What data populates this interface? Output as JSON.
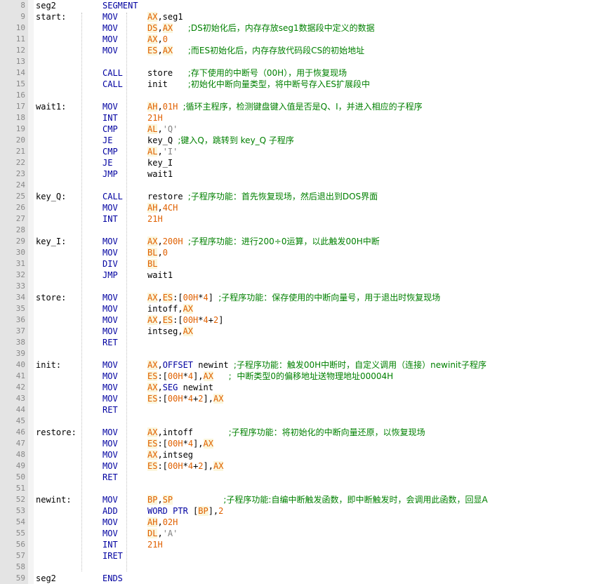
{
  "colors": {
    "background": "#ffffff",
    "gutter": "#e4e4e4",
    "line_number": "#888888",
    "instruction": "#0000a0",
    "register": "#e06000",
    "comment": "#008000",
    "string": "#808080"
  },
  "lines": [
    {
      "n": "8",
      "label": "seg2",
      "op": "SEGMENT",
      "args": []
    },
    {
      "n": "9",
      "label": "start:",
      "op": "MOV",
      "args": [
        {
          "t": "reg",
          "v": "AX"
        },
        {
          "t": "plain",
          "v": ",seg1"
        }
      ]
    },
    {
      "n": "10",
      "label": "",
      "op": "MOV",
      "args": [
        {
          "t": "reg",
          "v": "DS"
        },
        {
          "t": "plain",
          "v": ","
        },
        {
          "t": "reg",
          "v": "AX"
        },
        {
          "t": "plain",
          "v": "   "
        },
        {
          "t": "cmt",
          "v": ";DS初始化后，内存存放seg1数据段中定义的数据"
        }
      ]
    },
    {
      "n": "11",
      "label": "",
      "op": "MOV",
      "args": [
        {
          "t": "reg",
          "v": "AX"
        },
        {
          "t": "plain",
          "v": ","
        },
        {
          "t": "num",
          "v": "0"
        }
      ]
    },
    {
      "n": "12",
      "label": "",
      "op": "MOV",
      "args": [
        {
          "t": "reg",
          "v": "ES"
        },
        {
          "t": "plain",
          "v": ","
        },
        {
          "t": "reg",
          "v": "AX"
        },
        {
          "t": "plain",
          "v": "   "
        },
        {
          "t": "cmt",
          "v": ";而ES初始化后，内存存放代码段CS的初始地址"
        }
      ]
    },
    {
      "n": "13",
      "label": "",
      "op": "",
      "args": []
    },
    {
      "n": "14",
      "label": "",
      "op": "CALL",
      "args": [
        {
          "t": "plain",
          "v": "store   "
        },
        {
          "t": "cmt",
          "v": ";存下使用的中断号（00H），用于恢复现场"
        }
      ]
    },
    {
      "n": "15",
      "label": "",
      "op": "CALL",
      "args": [
        {
          "t": "plain",
          "v": "init    "
        },
        {
          "t": "cmt",
          "v": ";初始化中断向量类型，将中断号存入ES扩展段中"
        }
      ]
    },
    {
      "n": "16",
      "label": "",
      "op": "",
      "args": []
    },
    {
      "n": "17",
      "label": "wait1:",
      "op": "MOV",
      "args": [
        {
          "t": "reg",
          "v": "AH"
        },
        {
          "t": "plain",
          "v": ","
        },
        {
          "t": "num",
          "v": "01H"
        },
        {
          "t": "plain",
          "v": " "
        },
        {
          "t": "cmt",
          "v": ";循环主程序，检测键盘键入值是否是Q、I，并进入相应的子程序"
        }
      ]
    },
    {
      "n": "18",
      "label": "",
      "op": "INT",
      "args": [
        {
          "t": "num",
          "v": "21H"
        }
      ]
    },
    {
      "n": "19",
      "label": "",
      "op": "CMP",
      "args": [
        {
          "t": "reg",
          "v": "AL"
        },
        {
          "t": "plain",
          "v": ","
        },
        {
          "t": "str",
          "v": "'Q'"
        }
      ]
    },
    {
      "n": "20",
      "label": "",
      "op": "JE",
      "args": [
        {
          "t": "plain",
          "v": "key_Q "
        },
        {
          "t": "cmt",
          "v": ";键入Q，跳转到 key_Q 子程序"
        }
      ]
    },
    {
      "n": "21",
      "label": "",
      "op": "CMP",
      "args": [
        {
          "t": "reg",
          "v": "AL"
        },
        {
          "t": "plain",
          "v": ","
        },
        {
          "t": "str",
          "v": "'I'"
        }
      ]
    },
    {
      "n": "22",
      "label": "",
      "op": "JE",
      "args": [
        {
          "t": "plain",
          "v": "key_I"
        }
      ]
    },
    {
      "n": "23",
      "label": "",
      "op": "JMP",
      "args": [
        {
          "t": "plain",
          "v": "wait1"
        }
      ]
    },
    {
      "n": "24",
      "label": "",
      "op": "",
      "args": []
    },
    {
      "n": "25",
      "label": "key_Q:",
      "op": "CALL",
      "args": [
        {
          "t": "plain",
          "v": "restore "
        },
        {
          "t": "cmt",
          "v": ";子程序功能：首先恢复现场，然后退出到DOS界面"
        }
      ]
    },
    {
      "n": "26",
      "label": "",
      "op": "MOV",
      "args": [
        {
          "t": "reg",
          "v": "AH"
        },
        {
          "t": "plain",
          "v": ","
        },
        {
          "t": "num",
          "v": "4CH"
        }
      ]
    },
    {
      "n": "27",
      "label": "",
      "op": "INT",
      "args": [
        {
          "t": "num",
          "v": "21H"
        }
      ]
    },
    {
      "n": "28",
      "label": "",
      "op": "",
      "args": []
    },
    {
      "n": "29",
      "label": "key_I:",
      "op": "MOV",
      "args": [
        {
          "t": "reg",
          "v": "AX"
        },
        {
          "t": "plain",
          "v": ","
        },
        {
          "t": "num",
          "v": "200H"
        },
        {
          "t": "plain",
          "v": " "
        },
        {
          "t": "cmt",
          "v": ";子程序功能：进行200÷0运算，以此触发00H中断"
        }
      ]
    },
    {
      "n": "30",
      "label": "",
      "op": "MOV",
      "args": [
        {
          "t": "reg",
          "v": "BL"
        },
        {
          "t": "plain",
          "v": ","
        },
        {
          "t": "num",
          "v": "0"
        }
      ]
    },
    {
      "n": "31",
      "label": "",
      "op": "DIV",
      "args": [
        {
          "t": "reg",
          "v": "BL"
        }
      ]
    },
    {
      "n": "32",
      "label": "",
      "op": "JMP",
      "args": [
        {
          "t": "plain",
          "v": "wait1"
        }
      ]
    },
    {
      "n": "33",
      "label": "",
      "op": "",
      "args": []
    },
    {
      "n": "34",
      "label": "store:",
      "op": "MOV",
      "args": [
        {
          "t": "reg",
          "v": "AX"
        },
        {
          "t": "plain",
          "v": ","
        },
        {
          "t": "reg",
          "v": "ES"
        },
        {
          "t": "plain",
          "v": ":["
        },
        {
          "t": "num",
          "v": "00H"
        },
        {
          "t": "plain",
          "v": "*"
        },
        {
          "t": "num",
          "v": "4"
        },
        {
          "t": "plain",
          "v": "] "
        },
        {
          "t": "cmt",
          "v": ";子程序功能：保存使用的中断向量号，用于退出时恢复现场"
        }
      ]
    },
    {
      "n": "35",
      "label": "",
      "op": "MOV",
      "args": [
        {
          "t": "plain",
          "v": "intoff,"
        },
        {
          "t": "reg",
          "v": "AX"
        }
      ]
    },
    {
      "n": "36",
      "label": "",
      "op": "MOV",
      "args": [
        {
          "t": "reg",
          "v": "AX"
        },
        {
          "t": "plain",
          "v": ","
        },
        {
          "t": "reg",
          "v": "ES"
        },
        {
          "t": "plain",
          "v": ":["
        },
        {
          "t": "num",
          "v": "00H"
        },
        {
          "t": "plain",
          "v": "*"
        },
        {
          "t": "num",
          "v": "4"
        },
        {
          "t": "plain",
          "v": "+"
        },
        {
          "t": "num",
          "v": "2"
        },
        {
          "t": "plain",
          "v": "]"
        }
      ]
    },
    {
      "n": "37",
      "label": "",
      "op": "MOV",
      "args": [
        {
          "t": "plain",
          "v": "intseg,"
        },
        {
          "t": "reg",
          "v": "AX"
        }
      ]
    },
    {
      "n": "38",
      "label": "",
      "op": "RET",
      "args": []
    },
    {
      "n": "39",
      "label": "",
      "op": "",
      "args": []
    },
    {
      "n": "40",
      "label": "init:",
      "op": "MOV",
      "args": [
        {
          "t": "reg",
          "v": "AX"
        },
        {
          "t": "plain",
          "v": ","
        },
        {
          "t": "kw",
          "v": "OFFSET"
        },
        {
          "t": "plain",
          "v": " newint "
        },
        {
          "t": "cmt",
          "v": ";子程序功能：触发00H中断时，自定义调用（连接）newinit子程序"
        }
      ]
    },
    {
      "n": "41",
      "label": "",
      "op": "MOV",
      "args": [
        {
          "t": "reg",
          "v": "ES"
        },
        {
          "t": "plain",
          "v": ":["
        },
        {
          "t": "num",
          "v": "00H"
        },
        {
          "t": "plain",
          "v": "*"
        },
        {
          "t": "num",
          "v": "4"
        },
        {
          "t": "plain",
          "v": "],"
        },
        {
          "t": "reg",
          "v": "AX"
        },
        {
          "t": "plain",
          "v": "   "
        },
        {
          "t": "cmt",
          "v": ";  中断类型0的偏移地址送物理地址00004H"
        }
      ]
    },
    {
      "n": "42",
      "label": "",
      "op": "MOV",
      "args": [
        {
          "t": "reg",
          "v": "AX"
        },
        {
          "t": "plain",
          "v": ","
        },
        {
          "t": "kw",
          "v": "SEG"
        },
        {
          "t": "plain",
          "v": " newint"
        }
      ]
    },
    {
      "n": "43",
      "label": "",
      "op": "MOV",
      "args": [
        {
          "t": "reg",
          "v": "ES"
        },
        {
          "t": "plain",
          "v": ":["
        },
        {
          "t": "num",
          "v": "00H"
        },
        {
          "t": "plain",
          "v": "*"
        },
        {
          "t": "num",
          "v": "4"
        },
        {
          "t": "plain",
          "v": "+"
        },
        {
          "t": "num",
          "v": "2"
        },
        {
          "t": "plain",
          "v": "],"
        },
        {
          "t": "reg",
          "v": "AX"
        }
      ]
    },
    {
      "n": "44",
      "label": "",
      "op": "RET",
      "args": []
    },
    {
      "n": "45",
      "label": "",
      "op": "",
      "args": []
    },
    {
      "n": "46",
      "label": "restore:",
      "op": "MOV",
      "args": [
        {
          "t": "reg",
          "v": "AX"
        },
        {
          "t": "plain",
          "v": ",intoff       "
        },
        {
          "t": "cmt",
          "v": ";子程序功能：将初始化的中断向量还原，以恢复现场"
        }
      ]
    },
    {
      "n": "47",
      "label": "",
      "op": "MOV",
      "args": [
        {
          "t": "reg",
          "v": "ES"
        },
        {
          "t": "plain",
          "v": ":["
        },
        {
          "t": "num",
          "v": "00H"
        },
        {
          "t": "plain",
          "v": "*"
        },
        {
          "t": "num",
          "v": "4"
        },
        {
          "t": "plain",
          "v": "],"
        },
        {
          "t": "reg",
          "v": "AX"
        }
      ]
    },
    {
      "n": "48",
      "label": "",
      "op": "MOV",
      "args": [
        {
          "t": "reg",
          "v": "AX"
        },
        {
          "t": "plain",
          "v": ",intseg"
        }
      ]
    },
    {
      "n": "49",
      "label": "",
      "op": "MOV",
      "args": [
        {
          "t": "reg",
          "v": "ES"
        },
        {
          "t": "plain",
          "v": ":["
        },
        {
          "t": "num",
          "v": "00H"
        },
        {
          "t": "plain",
          "v": "*"
        },
        {
          "t": "num",
          "v": "4"
        },
        {
          "t": "plain",
          "v": "+"
        },
        {
          "t": "num",
          "v": "2"
        },
        {
          "t": "plain",
          "v": "],"
        },
        {
          "t": "reg",
          "v": "AX"
        }
      ]
    },
    {
      "n": "50",
      "label": "",
      "op": "RET",
      "args": []
    },
    {
      "n": "51",
      "label": "",
      "op": "",
      "args": []
    },
    {
      "n": "52",
      "label": "newint:",
      "op": "MOV",
      "args": [
        {
          "t": "reg",
          "v": "BP"
        },
        {
          "t": "plain",
          "v": ","
        },
        {
          "t": "reg",
          "v": "SP"
        },
        {
          "t": "plain",
          "v": "          "
        },
        {
          "t": "cmt",
          "v": ";子程序功能:自编中断触发函数，即中断触发时，会调用此函数，回显A"
        }
      ]
    },
    {
      "n": "53",
      "label": "",
      "op": "ADD",
      "args": [
        {
          "t": "kw",
          "v": "WORD PTR"
        },
        {
          "t": "plain",
          "v": " ["
        },
        {
          "t": "reg",
          "v": "BP"
        },
        {
          "t": "plain",
          "v": "],"
        },
        {
          "t": "num",
          "v": "2"
        }
      ]
    },
    {
      "n": "54",
      "label": "",
      "op": "MOV",
      "args": [
        {
          "t": "reg",
          "v": "AH"
        },
        {
          "t": "plain",
          "v": ","
        },
        {
          "t": "num",
          "v": "02H"
        }
      ]
    },
    {
      "n": "55",
      "label": "",
      "op": "MOV",
      "args": [
        {
          "t": "reg",
          "v": "DL"
        },
        {
          "t": "plain",
          "v": ","
        },
        {
          "t": "str",
          "v": "'A'"
        }
      ]
    },
    {
      "n": "56",
      "label": "",
      "op": "INT",
      "args": [
        {
          "t": "num",
          "v": "21H"
        }
      ]
    },
    {
      "n": "57",
      "label": "",
      "op": "IRET",
      "args": []
    },
    {
      "n": "58",
      "label": "",
      "op": "",
      "args": []
    },
    {
      "n": "59",
      "label": "seg2",
      "op": "ENDS",
      "args": []
    }
  ]
}
